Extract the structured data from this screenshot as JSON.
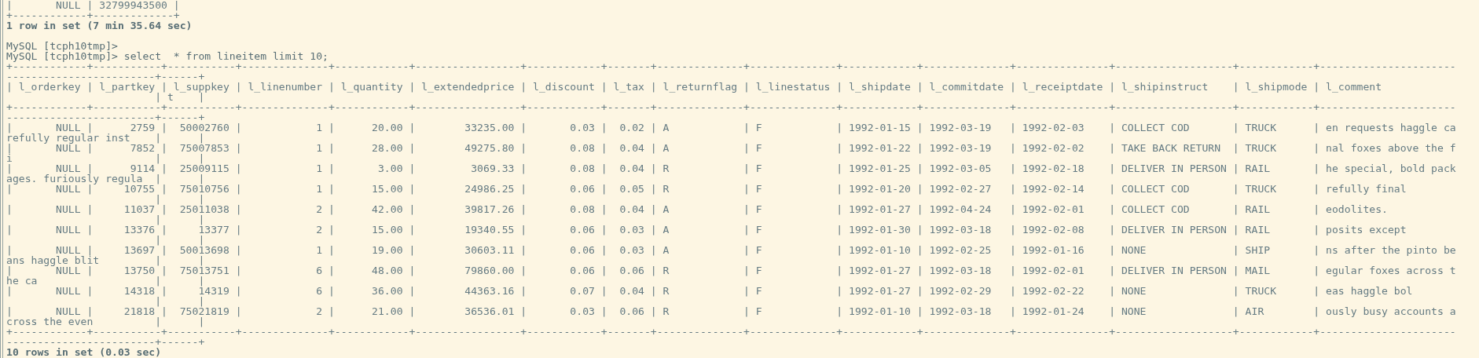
{
  "terminal": {
    "lines": [
      {
        "kind": "output",
        "text": "|       NULL | 32799943500 |"
      },
      {
        "kind": "output",
        "text": "+------------+-------------+"
      },
      {
        "kind": "status",
        "text": "1 row in set (7 min 35.64 sec)"
      },
      {
        "kind": "blank"
      },
      {
        "kind": "prompt",
        "text": "MySQL [tcph10tmp]>"
      },
      {
        "kind": "prompt",
        "text": "MySQL [tcph10tmp]> select  * from lineitem limit 10;"
      },
      {
        "kind": "output",
        "text": "+------------+-----------+-----------+--------------+------------+-----------------+------------+-------+--------------+--------------+------------+--------------+---------------+-------------------+------------+----------------------"
      },
      {
        "kind": "output",
        "text": "------------------------+------+"
      },
      {
        "kind": "output",
        "text": "| l_orderkey | l_partkey | l_suppkey | l_linenumber | l_quantity | l_extendedprice | l_discount | l_tax | l_returnflag | l_linestatus | l_shipdate | l_commitdate | l_receiptdate | l_shipinstruct    | l_shipmode | l_comment"
      },
      {
        "kind": "output",
        "text": "                        | t    |"
      },
      {
        "kind": "output",
        "text": "+------------+-----------+-----------+--------------+------------+-----------------+------------+-------+--------------+--------------+------------+--------------+---------------+-------------------+------------+----------------------"
      },
      {
        "kind": "output",
        "text": "------------------------+------+"
      },
      {
        "kind": "output",
        "text": "|       NULL |      2759 |  50002760 |            1 |      20.00 |        33235.00 |       0.03 |  0.02 | A            | F            | 1992-01-15 | 1992-03-19   | 1992-02-03    | COLLECT COD       | TRUCK      | en requests haggle ca"
      },
      {
        "kind": "output",
        "text": "refully regular inst    |      |"
      },
      {
        "kind": "output",
        "text": "|       NULL |      7852 |  75007853 |            1 |      28.00 |        49275.80 |       0.08 |  0.04 | A            | F            | 1992-01-22 | 1992-03-19   | 1992-02-02    | TAKE BACK RETURN  | TRUCK      | nal foxes above the f"
      },
      {
        "kind": "output",
        "text": "i                       |      |"
      },
      {
        "kind": "output",
        "text": "|       NULL |      9114 |  25009115 |            1 |       3.00 |         3069.33 |       0.08 |  0.04 | R            | F            | 1992-01-25 | 1992-03-05   | 1992-02-18    | DELIVER IN PERSON | RAIL       | he special, bold pack"
      },
      {
        "kind": "output",
        "text": "ages. furiously regula  |      |"
      },
      {
        "kind": "output",
        "text": "|       NULL |     10755 |  75010756 |            1 |      15.00 |        24986.25 |       0.06 |  0.05 | R            | F            | 1992-01-20 | 1992-02-27   | 1992-02-14    | COLLECT COD       | TRUCK      | refully final"
      },
      {
        "kind": "output",
        "text": "                        |      |"
      },
      {
        "kind": "output",
        "text": "|       NULL |     11037 |  25011038 |            2 |      42.00 |        39817.26 |       0.08 |  0.04 | A            | F            | 1992-01-27 | 1992-04-24   | 1992-02-01    | COLLECT COD       | RAIL       | eodolites."
      },
      {
        "kind": "output",
        "text": "                        |      |"
      },
      {
        "kind": "output",
        "text": "|       NULL |     13376 |     13377 |            2 |      15.00 |        19340.55 |       0.06 |  0.03 | A            | F            | 1992-01-30 | 1992-03-18   | 1992-02-08    | DELIVER IN PERSON | RAIL       | posits except"
      },
      {
        "kind": "output",
        "text": "                        |      |"
      },
      {
        "kind": "output",
        "text": "|       NULL |     13697 |  50013698 |            1 |      19.00 |        30603.11 |       0.06 |  0.03 | A            | F            | 1992-01-10 | 1992-02-25   | 1992-01-16    | NONE              | SHIP       | ns after the pinto be"
      },
      {
        "kind": "output",
        "text": "ans haggle blit         |      |"
      },
      {
        "kind": "output",
        "text": "|       NULL |     13750 |  75013751 |            6 |      48.00 |        79860.00 |       0.06 |  0.06 | R            | F            | 1992-01-27 | 1992-03-18   | 1992-02-01    | DELIVER IN PERSON | MAIL       | egular foxes across t"
      },
      {
        "kind": "output",
        "text": "he ca                   |      |"
      },
      {
        "kind": "output",
        "text": "|       NULL |     14318 |     14319 |            6 |      36.00 |        44363.16 |       0.07 |  0.04 | R            | F            | 1992-01-27 | 1992-02-29   | 1992-02-22    | NONE              | TRUCK      | eas haggle bol"
      },
      {
        "kind": "output",
        "text": "                        |      |"
      },
      {
        "kind": "output",
        "text": "|       NULL |     21818 |  75021819 |            2 |      21.00 |        36536.01 |       0.03 |  0.06 | R            | F            | 1992-01-10 | 1992-03-18   | 1992-01-24    | NONE              | AIR        | ously busy accounts a"
      },
      {
        "kind": "output",
        "text": "cross the even          |      |"
      },
      {
        "kind": "output",
        "text": "+------------+-----------+-----------+--------------+------------+-----------------+------------+-------+--------------+--------------+------------+--------------+---------------+-------------------+------------+----------------------"
      },
      {
        "kind": "output",
        "text": "------------------------+------+"
      },
      {
        "kind": "status",
        "text": "10 rows in set (0.03 sec)"
      }
    ]
  }
}
